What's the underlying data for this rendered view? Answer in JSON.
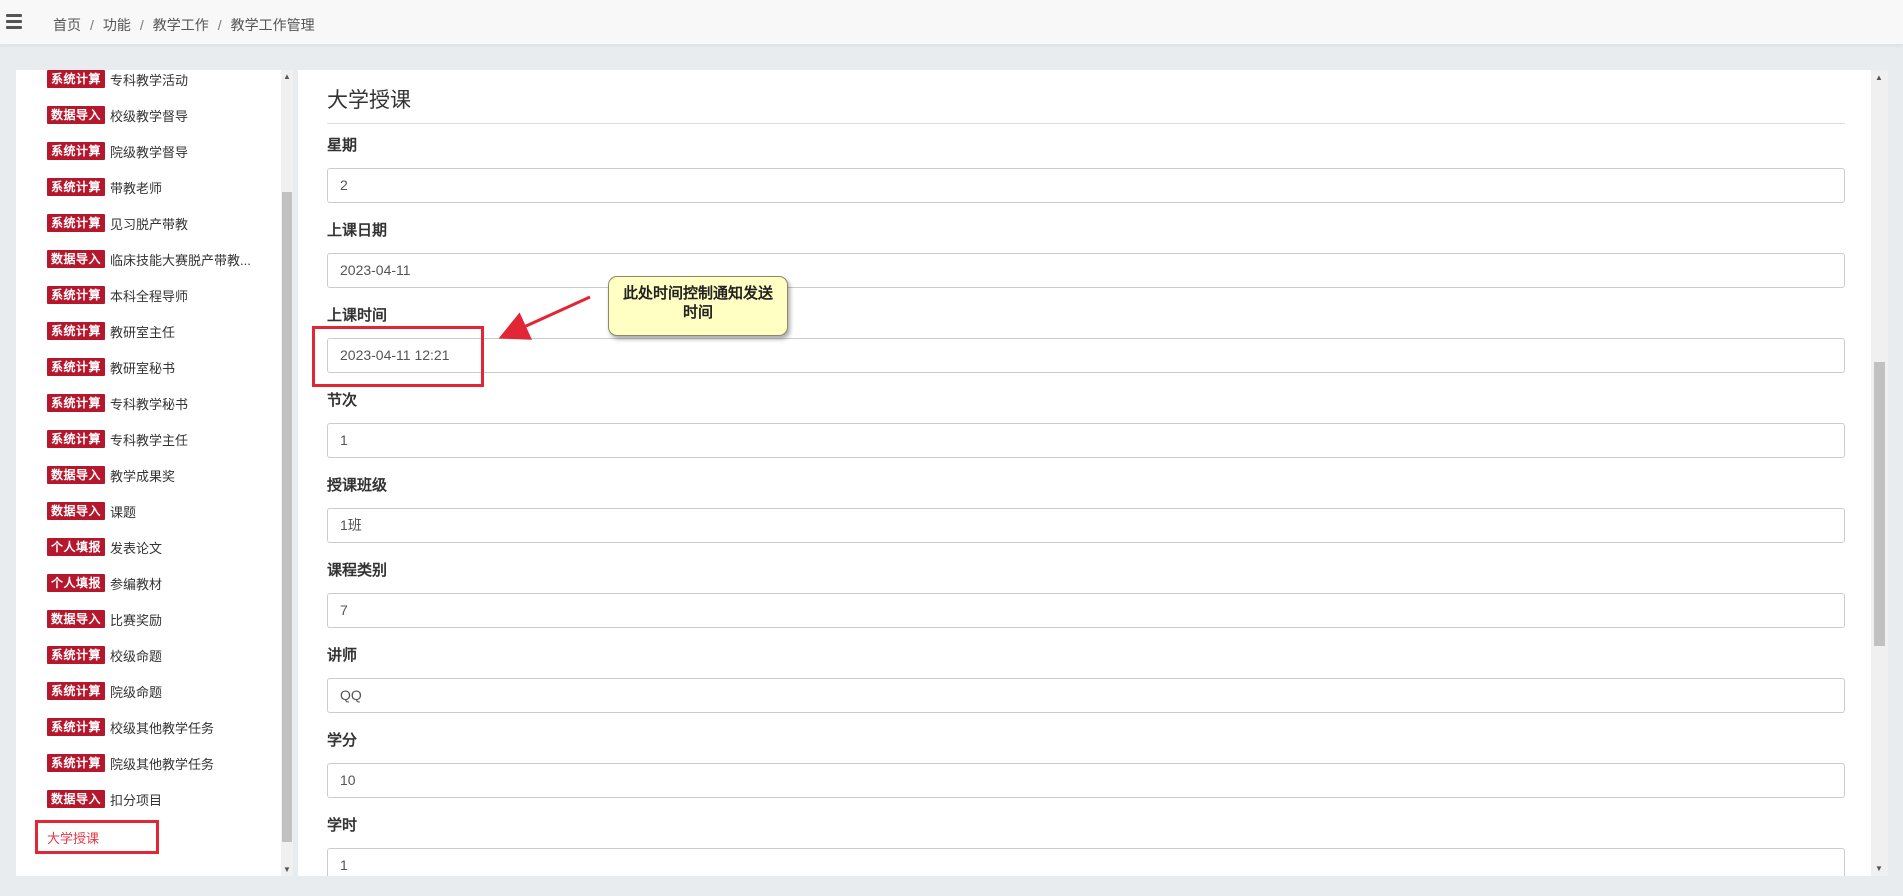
{
  "topbar": {
    "breadcrumb": [
      "首页",
      "功能",
      "教学工作",
      "教学工作管理"
    ],
    "separator": "/"
  },
  "sidebar": {
    "items": [
      {
        "badge": "系统计算",
        "label": "专科教学活动"
      },
      {
        "badge": "数据导入",
        "label": "校级教学督导"
      },
      {
        "badge": "系统计算",
        "label": "院级教学督导"
      },
      {
        "badge": "系统计算",
        "label": "带教老师"
      },
      {
        "badge": "系统计算",
        "label": "见习脱产带教"
      },
      {
        "badge": "数据导入",
        "label": "临床技能大赛脱产带教..."
      },
      {
        "badge": "系统计算",
        "label": "本科全程导师"
      },
      {
        "badge": "系统计算",
        "label": "教研室主任"
      },
      {
        "badge": "系统计算",
        "label": "教研室秘书"
      },
      {
        "badge": "系统计算",
        "label": "专科教学秘书"
      },
      {
        "badge": "系统计算",
        "label": "专科教学主任"
      },
      {
        "badge": "数据导入",
        "label": "教学成果奖"
      },
      {
        "badge": "数据导入",
        "label": "课题"
      },
      {
        "badge": "个人填报",
        "label": "发表论文"
      },
      {
        "badge": "个人填报",
        "label": "参编教材"
      },
      {
        "badge": "数据导入",
        "label": "比赛奖励"
      },
      {
        "badge": "系统计算",
        "label": "校级命题"
      },
      {
        "badge": "系统计算",
        "label": "院级命题"
      },
      {
        "badge": "系统计算",
        "label": "校级其他教学任务"
      },
      {
        "badge": "系统计算",
        "label": "院级其他教学任务"
      },
      {
        "badge": "数据导入",
        "label": "扣分项目"
      }
    ],
    "active_item": "大学授课"
  },
  "form": {
    "title": "大学授课",
    "fields": [
      {
        "label": "星期",
        "value": "2"
      },
      {
        "label": "上课日期",
        "value": "2023-04-11"
      },
      {
        "label": "上课时间",
        "value": "2023-04-11 12:21"
      },
      {
        "label": "节次",
        "value": "1"
      },
      {
        "label": "授课班级",
        "value": "1班"
      },
      {
        "label": "课程类别",
        "value": "7"
      },
      {
        "label": "讲师",
        "value": "QQ"
      },
      {
        "label": "学分",
        "value": "10"
      },
      {
        "label": "学时",
        "value": "1"
      }
    ]
  },
  "annotation": {
    "callout_text": "此处时间控制通知发送时间",
    "accent_color": "#e32636"
  },
  "colors": {
    "badge_bg": "#b5172d",
    "active_link": "#e63946"
  }
}
